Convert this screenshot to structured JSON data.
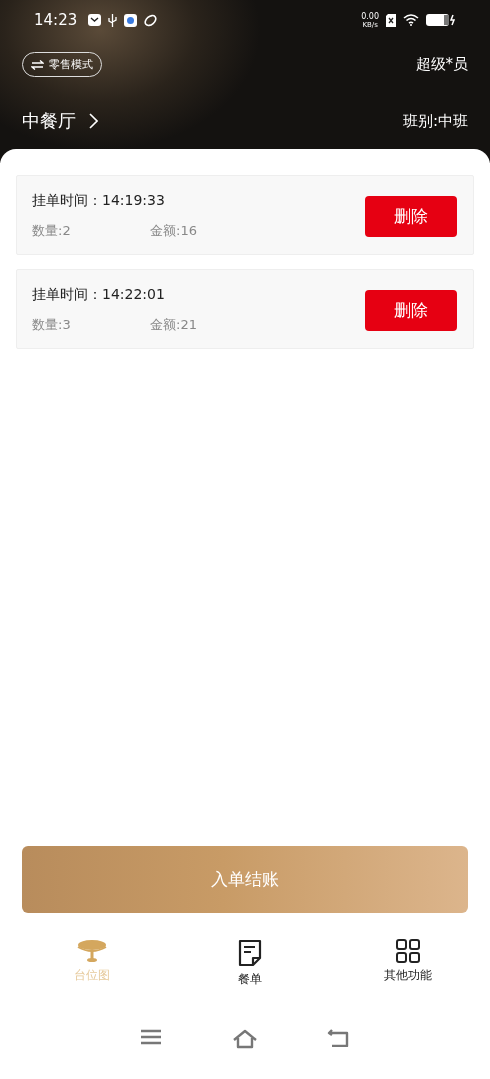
{
  "status_bar": {
    "time": "14:23",
    "net_speed": "0.00",
    "net_unit": "KB/s"
  },
  "header": {
    "mode_button": "零售模式",
    "user": "超级*员",
    "venue": "中餐厅",
    "shift": "班别:中班"
  },
  "orders": [
    {
      "time_label": "挂单时间：14:19:33",
      "quantity": "数量:2",
      "amount": "金额:16",
      "delete": "删除"
    },
    {
      "time_label": "挂单时间：14:22:01",
      "quantity": "数量:3",
      "amount": "金额:21",
      "delete": "删除"
    }
  ],
  "checkout_button": "入单结账",
  "tabs": [
    {
      "label": "台位图",
      "kind": "table",
      "selected": true
    },
    {
      "label": "餐单",
      "kind": "menu",
      "selected": false
    },
    {
      "label": "其他功能",
      "kind": "grid",
      "selected": false
    }
  ]
}
